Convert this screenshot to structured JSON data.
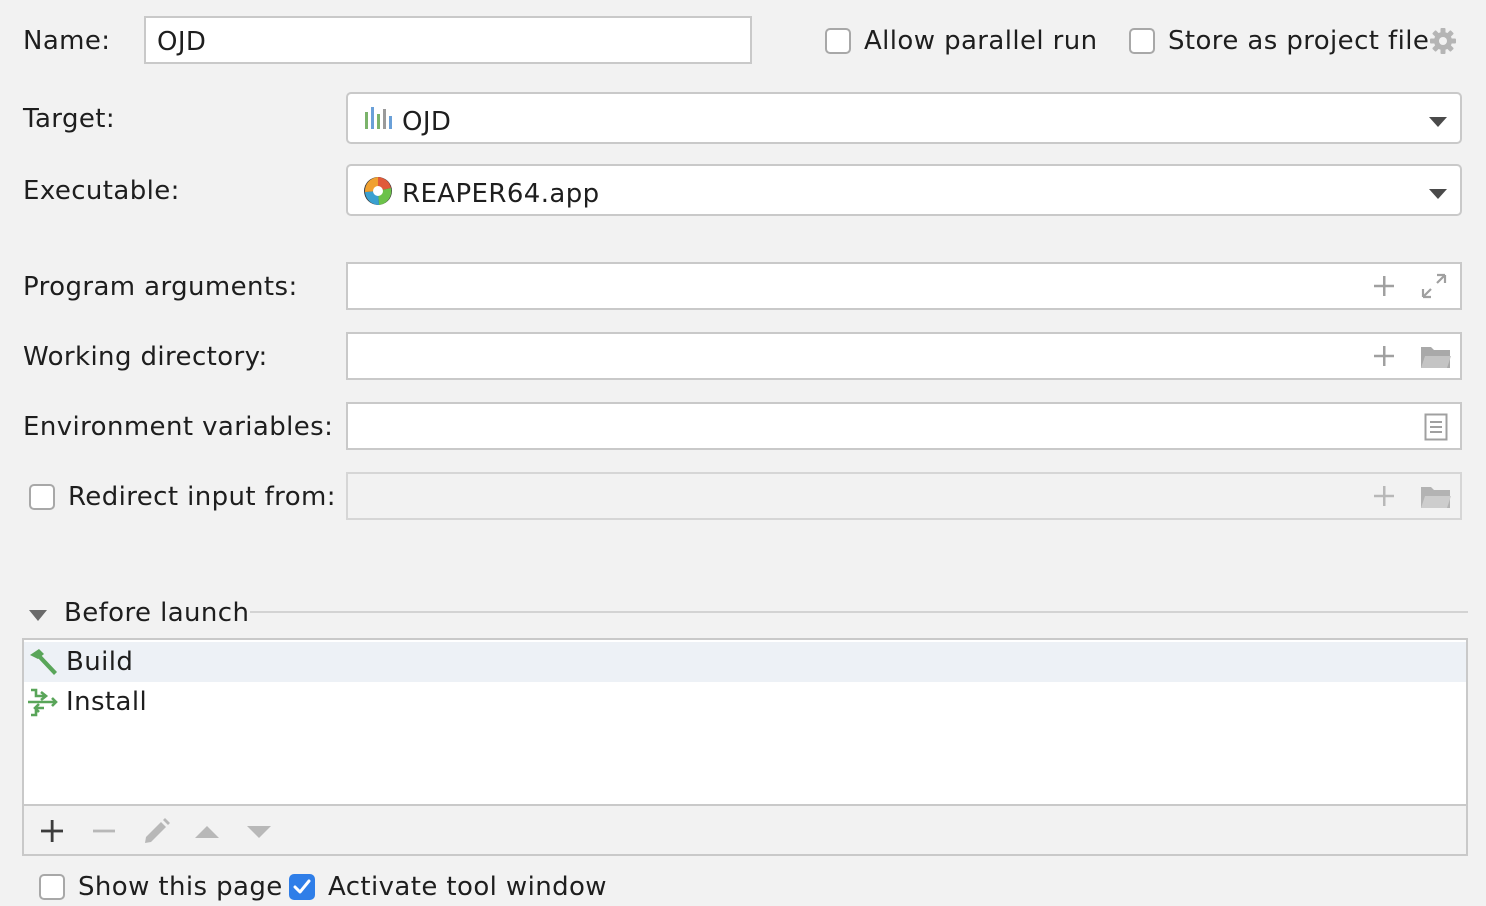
{
  "name_row": {
    "label": "Name:",
    "value": "OJD",
    "allow_parallel_label": "Allow parallel run",
    "allow_parallel_checked": false,
    "store_project_label": "Store as project file",
    "store_project_checked": false,
    "settings_icon": "gear-icon"
  },
  "target": {
    "label": "Target:",
    "value": "OJD",
    "icon": "target-bars-icon"
  },
  "executable": {
    "label": "Executable:",
    "value": "REAPER64.app",
    "icon": "reaper-app-icon"
  },
  "program_arguments": {
    "label": "Program arguments:",
    "value": ""
  },
  "working_directory": {
    "label": "Working directory:",
    "value": ""
  },
  "environment_variables": {
    "label": "Environment variables:",
    "value": ""
  },
  "redirect_input": {
    "label": "Redirect input from:",
    "checked": false,
    "value": ""
  },
  "before_launch": {
    "title": "Before launch",
    "items": [
      {
        "label": "Build",
        "icon": "hammer-icon",
        "selected": true
      },
      {
        "label": "Install",
        "icon": "install-icon",
        "selected": false
      }
    ]
  },
  "footer": {
    "show_page_label": "Show this page",
    "show_page_checked": false,
    "activate_tool_label": "Activate tool window",
    "activate_tool_checked": true
  },
  "colors": {
    "accent": "#2f7ee8",
    "selection": "#edf1f6",
    "icon_gray": "#9e9e9e",
    "green": "#5aa45a"
  }
}
